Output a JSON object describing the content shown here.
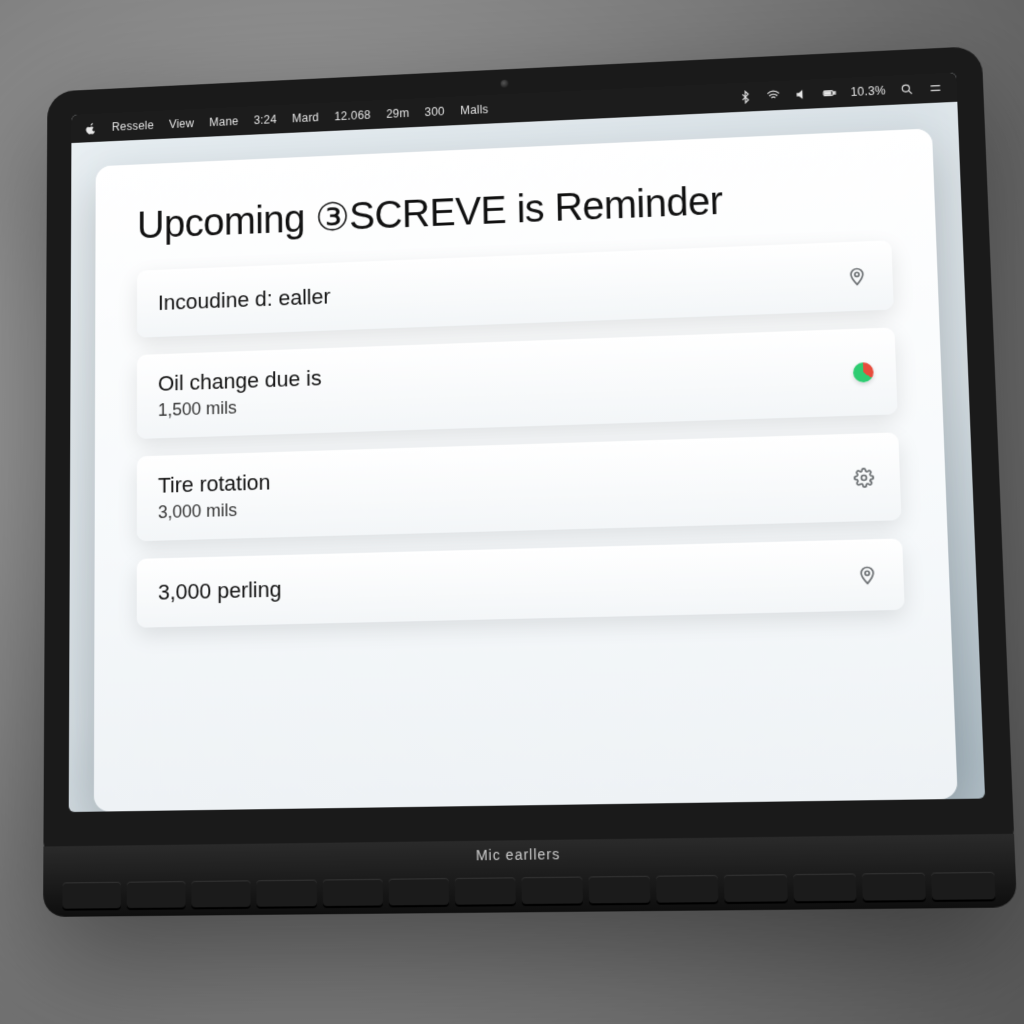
{
  "menubar": {
    "items": [
      "Ressele",
      "View",
      "Mane",
      "3:24",
      "Mard",
      "12.068",
      "29m",
      "300",
      "Malls"
    ],
    "status_text": "10.3%"
  },
  "page": {
    "title": "Upcoming ③SCREVE is Reminder"
  },
  "reminders": [
    {
      "title": "Incoudine d: ealler",
      "sub": "",
      "icon": "location-icon"
    },
    {
      "title": "Oil change due is",
      "sub": "1,500 mils",
      "icon": "status-dot"
    },
    {
      "title": "Tire rotation",
      "sub": "3,000 mils",
      "icon": "gear-icon"
    },
    {
      "title": "3,000 perling",
      "sub": "",
      "icon": "location-icon"
    }
  ],
  "brand": "Mic earllers"
}
